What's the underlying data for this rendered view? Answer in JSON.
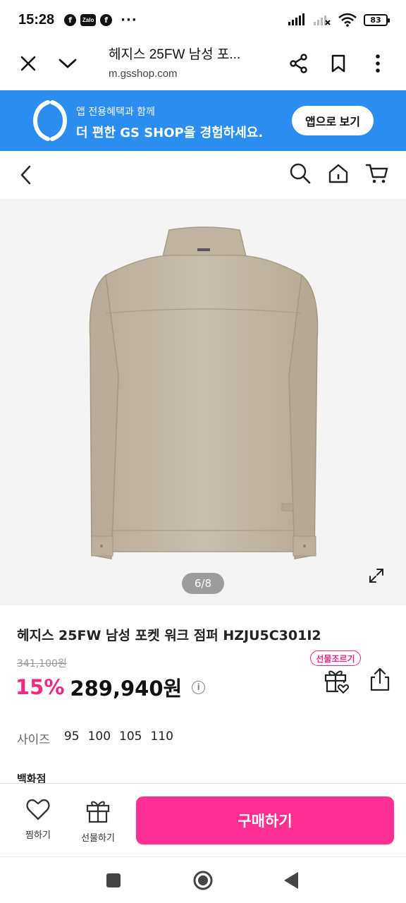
{
  "status_bar": {
    "time": "15:28",
    "facebook_glyph": "f",
    "zalo_label": "Zalo",
    "overflow": "···",
    "battery": "83",
    "icons": [
      "facebook-icon",
      "zalo-icon",
      "facebook-icon",
      "signal-icon",
      "signal-off-icon",
      "wifi-icon",
      "battery-icon"
    ]
  },
  "browser": {
    "page_title": "헤지스 25FW 남성 포...",
    "url": "m.gsshop.com",
    "icons": [
      "close-icon",
      "chevron-down-icon",
      "share-icon",
      "bookmark-icon",
      "more-vert-icon"
    ]
  },
  "promo_banner": {
    "line1": "앱 전용혜택과 함께",
    "line2": "더 편한 GS SHOP을 경험하세요.",
    "button_label": "앱으로 보기",
    "background_color": "#2b8df0"
  },
  "site_header": {
    "icons": [
      "back-arrow-icon",
      "search-icon",
      "home-icon",
      "cart-icon"
    ]
  },
  "gallery": {
    "indicator": "6/8",
    "image_subject": "beige men's work jacket, back view",
    "icons": [
      "expand-icon"
    ]
  },
  "product": {
    "title": "헤지스 25FW 남성 포켓 워크 점퍼 HZJU5C301I2",
    "original_price": "341,100원",
    "discount_rate": "15%",
    "sale_price": "289,940원",
    "info_glyph": "i",
    "gift_request_badge": "선물조르기",
    "accent_color": "#f02a82",
    "icons": [
      "info-icon",
      "gift-heart-icon",
      "share-upload-icon"
    ]
  },
  "options": {
    "size_label": "사이즈",
    "sizes": [
      "95",
      "100",
      "105",
      "110"
    ],
    "store_label": "백화점"
  },
  "action_bar": {
    "wishlist_label": "찜하기",
    "gift_label": "선물하기",
    "buy_label": "구매하기",
    "buy_color": "#fd2f93",
    "icons": [
      "heart-icon",
      "gift-icon"
    ]
  },
  "nav_bar": {
    "icons": [
      "recents-icon",
      "home-circle-icon",
      "back-triangle-icon"
    ]
  }
}
